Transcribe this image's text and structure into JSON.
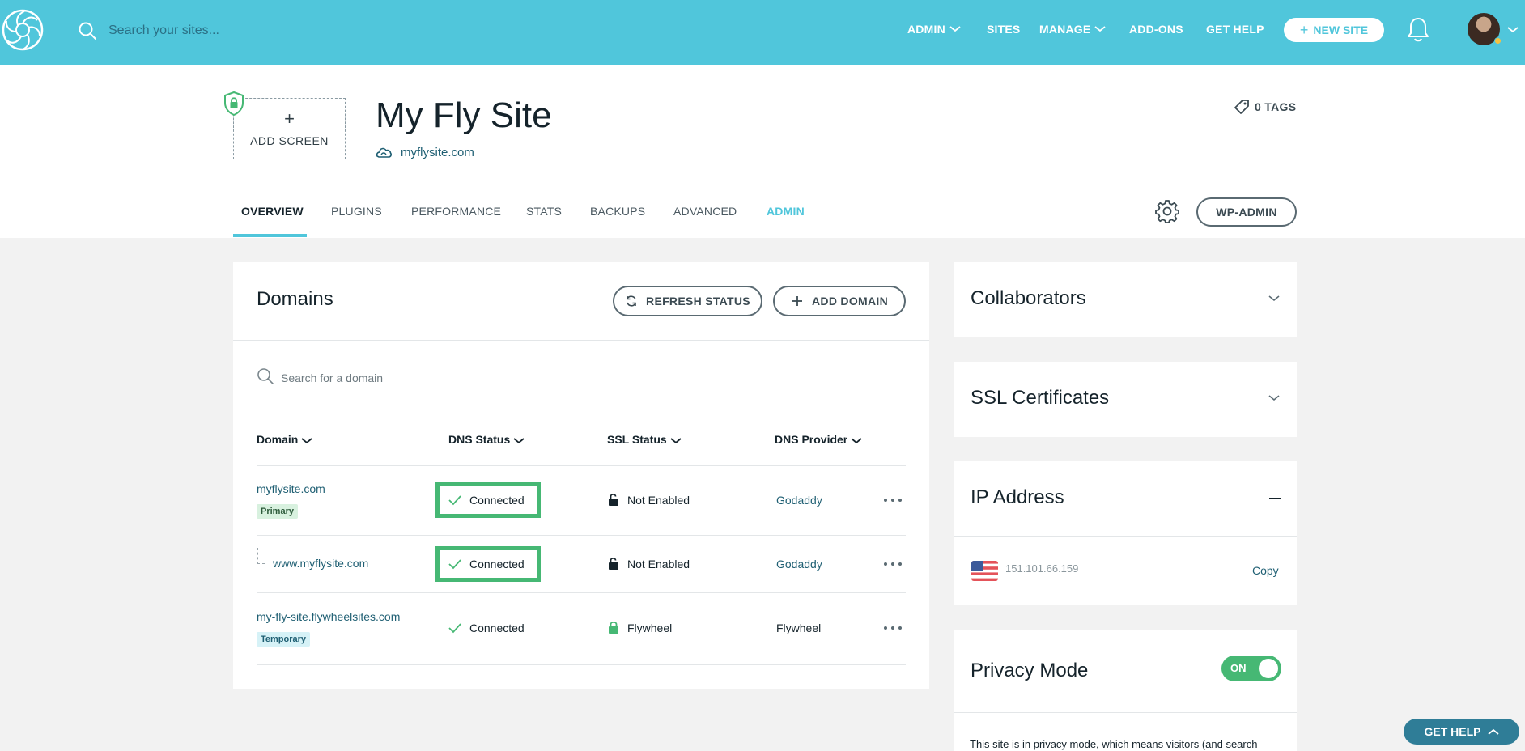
{
  "topbar": {
    "search_placeholder": "Search your sites...",
    "nav": [
      {
        "label": "ADMIN",
        "has_dropdown": true
      },
      {
        "label": "SITES",
        "has_dropdown": false
      },
      {
        "label": "MANAGE",
        "has_dropdown": true
      },
      {
        "label": "ADD-ONS",
        "has_dropdown": false
      },
      {
        "label": "GET HELP",
        "has_dropdown": false
      }
    ],
    "new_site_label": "NEW SITE",
    "icons": [
      "flywheel-logo-icon",
      "search-icon",
      "bell-icon",
      "avatar",
      "chevron-down-icon"
    ]
  },
  "site": {
    "add_screen_label": "ADD SCREEN",
    "title": "My Fly Site",
    "url": "myflysite.com",
    "tags_label": "0 TAGS",
    "tabs": [
      "OVERVIEW",
      "PLUGINS",
      "PERFORMANCE",
      "STATS",
      "BACKUPS",
      "ADVANCED",
      "ADMIN"
    ],
    "active_tab": "OVERVIEW",
    "wp_admin_label": "WP-ADMIN"
  },
  "domains": {
    "title": "Domains",
    "refresh_label": "REFRESH STATUS",
    "add_label": "ADD DOMAIN",
    "search_placeholder": "Search for a domain",
    "columns": [
      "Domain",
      "DNS Status",
      "SSL Status",
      "DNS Provider"
    ],
    "rows": [
      {
        "domain": "myflysite.com",
        "badge": "Primary",
        "dns_status": "Connected",
        "ssl_status": "Not Enabled",
        "provider": "Godaddy",
        "highlighted": true
      },
      {
        "domain": "www.myflysite.com",
        "badge": "",
        "dns_status": "Connected",
        "ssl_status": "Not Enabled",
        "provider": "Godaddy",
        "highlighted": true
      },
      {
        "domain": "my-fly-site.flywheelsites.com",
        "badge": "Temporary",
        "dns_status": "Connected",
        "ssl_status": "Flywheel",
        "provider": "Flywheel",
        "highlighted": false
      }
    ]
  },
  "sidebar": {
    "collaborators_title": "Collaborators",
    "ssl_title": "SSL Certificates",
    "ip_title": "IP Address",
    "ip_value": "151.101.66.159",
    "copy_label": "Copy",
    "privacy_title": "Privacy Mode",
    "privacy_toggle": "ON",
    "privacy_text": "This site is in privacy mode, which means visitors (and search"
  },
  "help_button_label": "GET HELP",
  "colors": {
    "topbar": "#50c6db",
    "accent": "#50c6db",
    "link": "#1f5f73",
    "success": "#46b874",
    "help": "#2f7d97"
  }
}
